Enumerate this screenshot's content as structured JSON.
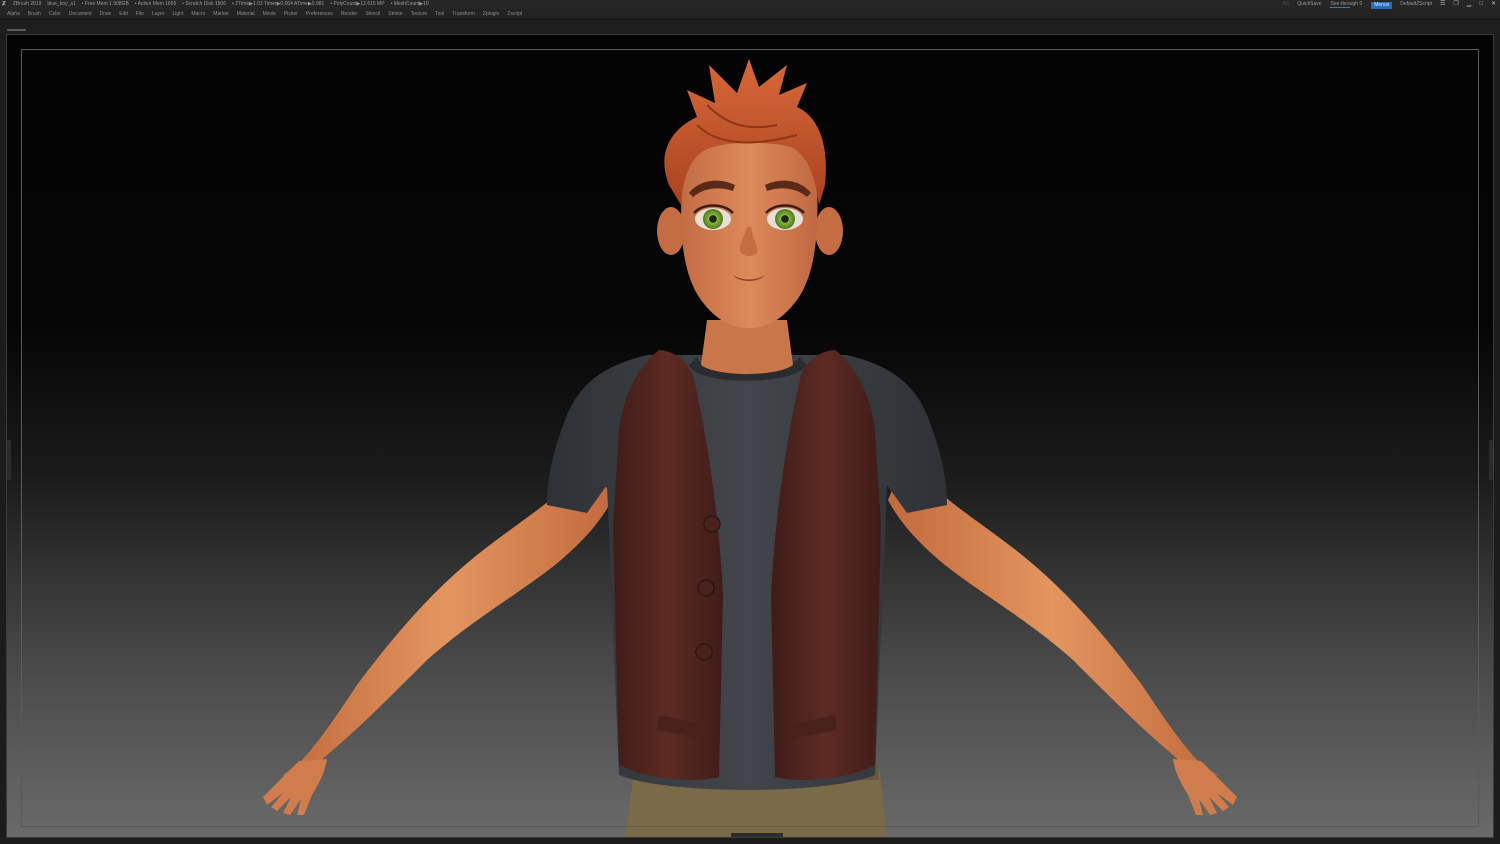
{
  "titlebar": {
    "app": "ZBrush 2019",
    "file": "blue_boy_s1",
    "stats": [
      "• Free Mem 1.908GB",
      "• Active Mem 1665",
      "• Scratch Disk 1506",
      "• ZTime▶1.03 Timer▶0.004 ATime▶0.981",
      "• PolyCount▶12.615 MP",
      "• MeshCount▶10"
    ],
    "ac": "AC",
    "quicksave": "QuickSave",
    "seethrough": "See-through  0",
    "menus": "Menus",
    "script": "DefaultZScript"
  },
  "menubar": [
    "Alpha",
    "Brush",
    "Color",
    "Document",
    "Draw",
    "Edit",
    "File",
    "Layer",
    "Light",
    "Macro",
    "Marker",
    "Material",
    "Movie",
    "Picker",
    "Preferences",
    "Render",
    "Stencil",
    "Stroke",
    "Texture",
    "Tool",
    "Transform",
    "Zplugin",
    "Zscript"
  ],
  "colors": {
    "skin": "#d98a5c",
    "hair": "#c8582a",
    "vest": "#5a2a24",
    "shirt": "#3c3f44",
    "pants": "#7a6a48",
    "eyes": "#6a9a2a",
    "accent": "#2a6db6"
  },
  "icons": {
    "logo": "zbrush-logo-icon",
    "window": [
      "palette-icon",
      "restore-icon",
      "minimize-icon",
      "maximize-icon",
      "close-icon"
    ]
  }
}
